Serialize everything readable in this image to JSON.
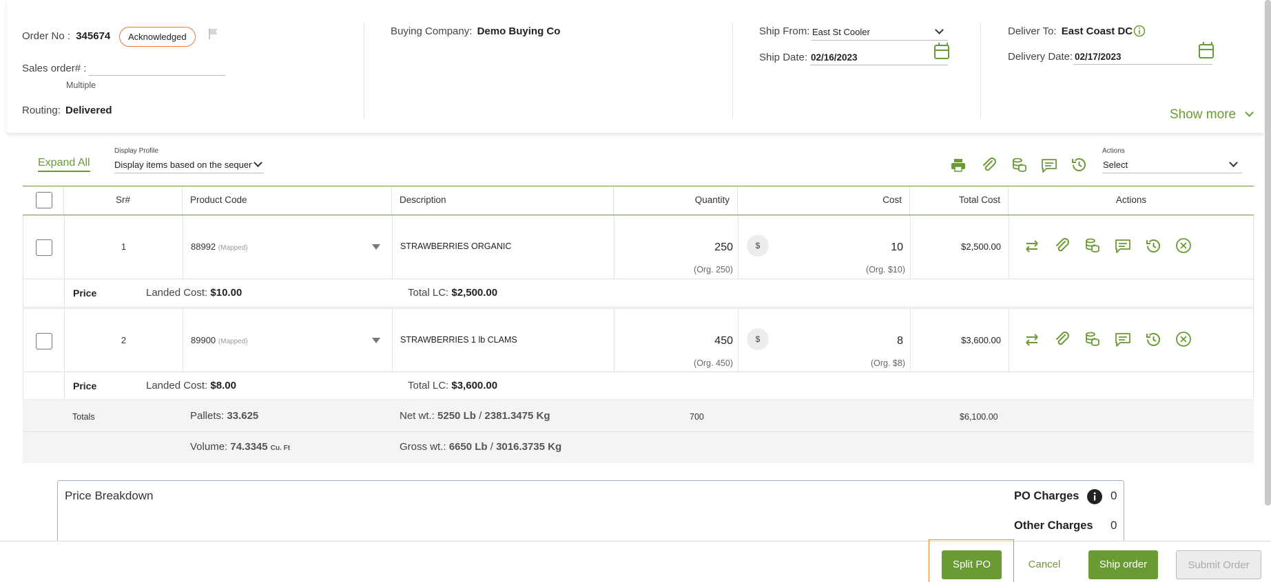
{
  "header": {
    "order_no_label": "Order No :",
    "order_no": "345674",
    "status": "Acknowledged",
    "sales_order_label": "Sales order# :",
    "sales_order_hint": "Multiple",
    "routing_label": "Routing:",
    "routing": "Delivered",
    "buying_company_label": "Buying Company:",
    "buying_company": "Demo Buying Co",
    "ship_from_label": "Ship From:",
    "ship_from": "East St Cooler",
    "ship_date_label": "Ship Date:",
    "ship_date": "02/16/2023",
    "deliver_to_label": "Deliver To:",
    "deliver_to": "East Coast DC",
    "delivery_date_label": "Delivery Date:",
    "delivery_date": "02/17/2023",
    "show_more": "Show more"
  },
  "toolbar": {
    "expand_all": "Expand All",
    "display_profile_label": "Display Profile",
    "display_profile_value": "Display items based on the sequen",
    "actions_label": "Actions",
    "actions_value": "Select"
  },
  "table": {
    "columns": {
      "sr": "Sr#",
      "product_code": "Product Code",
      "description": "Description",
      "quantity": "Quantity",
      "cost": "Cost",
      "total_cost": "Total Cost",
      "actions": "Actions"
    },
    "rows": [
      {
        "sr": "1",
        "code": "88992",
        "mapped": "(Mapped)",
        "description": "STRAWBERRIES ORGANIC",
        "quantity": "250",
        "org_qty": "(Org. 250)",
        "currency": "$",
        "cost": "10",
        "org_cost": "(Org. $10)",
        "total": "$2,500.00",
        "price_label": "Price",
        "landed_label": "Landed Cost:",
        "landed": "$10.00",
        "total_lc_label": "Total LC:",
        "total_lc": "$2,500.00"
      },
      {
        "sr": "2",
        "code": "89900",
        "mapped": "(Mapped)",
        "description": "STRAWBERRIES 1 lb CLAMS",
        "quantity": "450",
        "org_qty": "(Org. 450)",
        "currency": "$",
        "cost": "8",
        "org_cost": "(Org. $8)",
        "total": "$3,600.00",
        "price_label": "Price",
        "landed_label": "Landed Cost:",
        "landed": "$8.00",
        "total_lc_label": "Total LC:",
        "total_lc": "$3,600.00"
      }
    ],
    "totals": {
      "label": "Totals",
      "pallets_label": "Pallets:",
      "pallets": "33.625",
      "net_wt_label": "Net wt.:",
      "net_wt_lb": "5250 Lb",
      "net_wt_sep": "/",
      "net_wt_kg": "2381.3475 Kg",
      "quantity": "700",
      "total_cost": "$6,100.00",
      "volume_label": "Volume:",
      "volume": "74.3345",
      "volume_unit": "Cu. Ft",
      "gross_wt_label": "Gross wt.:",
      "gross_wt_lb": "6650 Lb",
      "gross_wt_sep": "/",
      "gross_wt_kg": "3016.3735 Kg"
    }
  },
  "price_breakdown": {
    "title": "Price Breakdown",
    "po_charges_label": "PO Charges",
    "po_charges": "0",
    "other_charges_label": "Other Charges",
    "other_charges": "0"
  },
  "footer": {
    "split_po": "Split PO",
    "cancel": "Cancel",
    "ship_order": "Ship order",
    "submit_order": "Submit Order"
  },
  "colors": {
    "accent": "#6a9a34",
    "status_border": "#e8783a",
    "highlight": "#f08a2c"
  }
}
